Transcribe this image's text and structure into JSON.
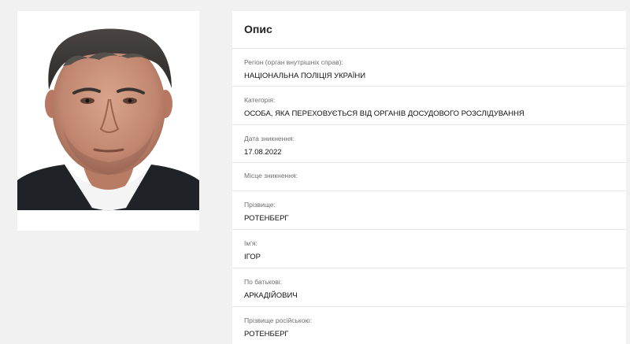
{
  "card": {
    "title": "Опис"
  },
  "fields": {
    "region": {
      "label": "Регіон (орган внутрішніх справ):",
      "value": "НАЦІОНАЛЬНА ПОЛІЦІЯ УКРАЇНИ"
    },
    "category": {
      "label": "Категорія:",
      "value": "ОСОБА, ЯКА ПЕРЕХОВУЄТЬСЯ ВІД ОРГАНІВ ДОСУДОВОГО РОЗСЛІДУВАННЯ"
    },
    "date": {
      "label": "Дата зникнення:",
      "value": "17.08.2022"
    },
    "place": {
      "label": "Місце зникнення:",
      "value": ""
    },
    "surname": {
      "label": "Прізвище:",
      "value": "РОТЕНБЕРГ"
    },
    "name": {
      "label": "Ім'я:",
      "value": "ІГОР"
    },
    "patronymic": {
      "label": "По батькові:",
      "value": "АРКАДІЙОВИЧ"
    },
    "surname_ru": {
      "label": "Прізвище російською:",
      "value": "РОТЕНБЕРГ"
    }
  },
  "colors": {
    "page_background": "#f1f1f1",
    "card_background": "#ffffff",
    "label_text": "#6d6d6d",
    "value_text": "#111111",
    "divider": "#e6e6e6"
  }
}
